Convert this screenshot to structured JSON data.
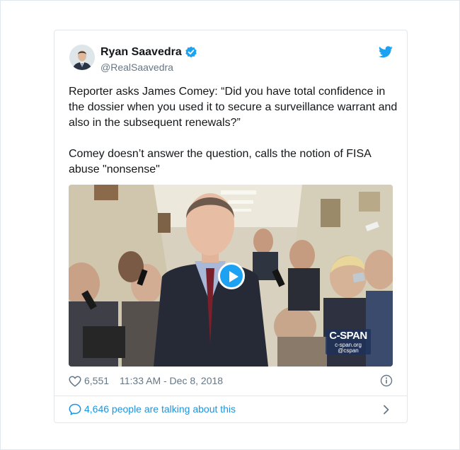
{
  "author": {
    "name": "Ryan Saavedra",
    "handle": "@RealSaavedra",
    "verified": true
  },
  "tweet": {
    "paragraphs": [
      "Reporter asks James Comey: “Did you have total confidence in the dossier when you used it to secure a surveillance warrant and also in the subsequent renewals?”",
      "Comey doesn’t answer the question, calls the notion of FISA abuse \"nonsense\""
    ]
  },
  "media": {
    "type": "video",
    "watermark_title": "C-SPAN",
    "watermark_url": "c-span.org",
    "watermark_handle": "@cspan"
  },
  "footer": {
    "likes": "6,551",
    "timestamp": "11:33 AM - Dec 8, 2018"
  },
  "conversation": {
    "label": "4,646 people are talking about this"
  },
  "colors": {
    "accent": "#1da1f2",
    "link": "#1b95e0",
    "text": "#14171a",
    "muted": "#657786",
    "border": "#e1e8ed"
  },
  "icons": [
    "verified-icon",
    "twitter-bird-icon",
    "play-icon",
    "heart-icon",
    "info-icon",
    "reply-icon",
    "chevron-right-icon"
  ]
}
